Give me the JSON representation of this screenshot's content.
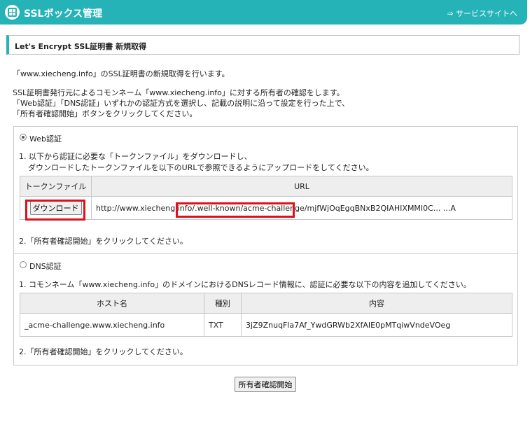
{
  "header": {
    "title": "SSLボックス管理",
    "service_link": "⇒ サービスサイトへ"
  },
  "section": {
    "title": "Let's Encrypt SSL証明書 新規取得"
  },
  "intro": {
    "line1": "「www.xiecheng.info」のSSL証明書の新規取得を行います。",
    "line2": "SSL証明書発行元によるコモンネーム「www.xiecheng.info」に対する所有者の確認をします。",
    "line3": "「Web認証」「DNS認証」いずれかの認証方式を選択し、記載の説明に沿って設定を行った上で、",
    "line4": "「所有者確認開始」ボタンをクリックしてください。"
  },
  "web_auth": {
    "radio_label": "Web認証",
    "selected": true,
    "step1_line1": "1. 以下から認証に必要な「トークンファイル」をダウンロードし、",
    "step1_line2": "ダウンロードしたトークンファイルを以下のURLで参照できるようにアップロードをしてください。",
    "table": {
      "col_token": "トークンファイル",
      "col_url": "URL",
      "download_label": "ダウンロード",
      "url_prefix": "http://www.xiecheng.info",
      "url_path": "/.well-known/acme-challenge/",
      "url_token": "mjfWjOqEgqBNxB2QIAHIXMMI0C... ...A"
    },
    "step2": "2.「所有者確認開始」をクリックしてください。"
  },
  "dns_auth": {
    "radio_label": "DNS認証",
    "selected": false,
    "step1": "1. コモンネーム「www.xiecheng.info」のドメインにおけるDNSレコード情報に、認証に必要な以下の内容を追加してください。",
    "table": {
      "col_host": "ホスト名",
      "col_type": "種別",
      "col_content": "内容",
      "host": "_acme-challenge.www.xiecheng.info",
      "type": "TXT",
      "content": "3jZ9ZnuqFla7Af_YwdGRWb2XfAIE0pMTqiwVndeVOeg"
    },
    "step2": "2.「所有者確認開始」をクリックしてください。"
  },
  "confirm_button": "所有者確認開始",
  "colors": {
    "header": "#25b3b7",
    "highlight": "#e0101a"
  }
}
